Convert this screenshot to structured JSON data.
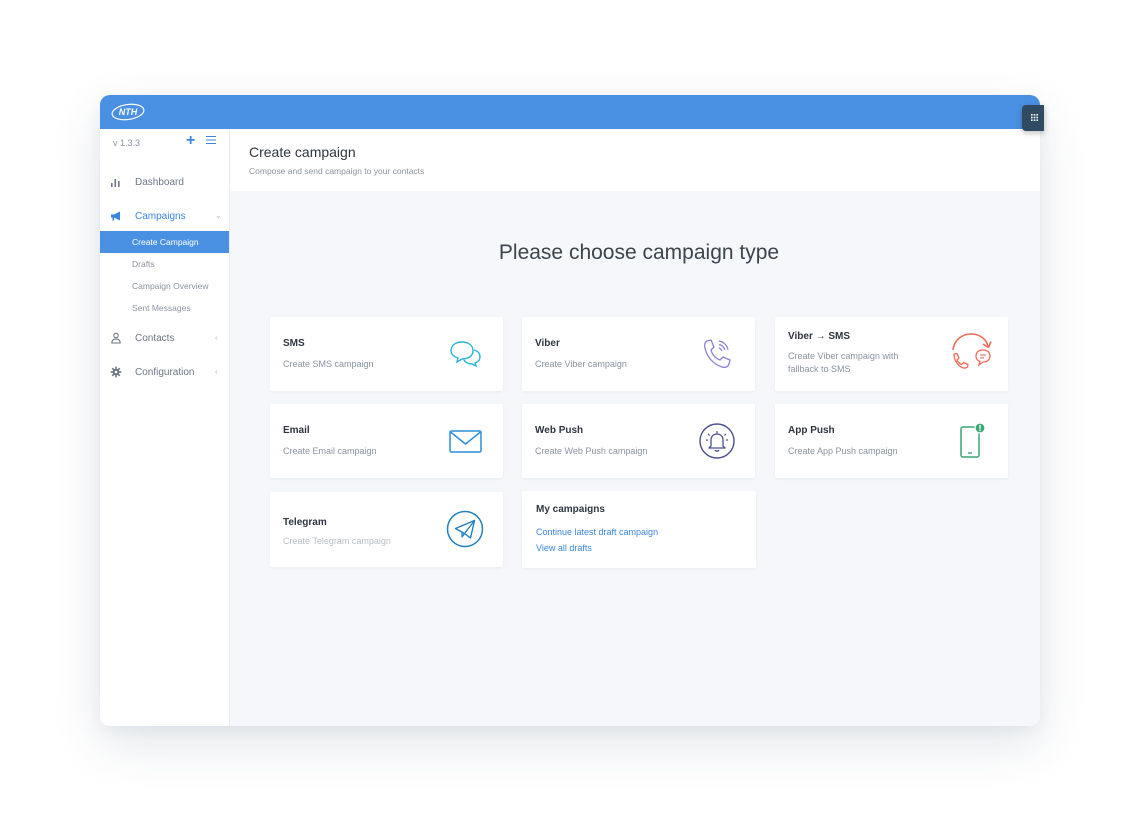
{
  "app": {
    "logo_text": "NTH",
    "version": "v 1.3.3",
    "accent_color": "#4a90e2"
  },
  "sidebar": {
    "add_icon": "plus-icon",
    "menu_icon": "hamburger-icon",
    "items": [
      {
        "label": "Dashboard",
        "icon": "bar-chart-icon"
      },
      {
        "label": "Campaigns",
        "icon": "megaphone-icon",
        "caret": "⌄"
      },
      {
        "label": "Contacts",
        "icon": "user-icon",
        "caret": "‹"
      },
      {
        "label": "Configuration",
        "icon": "gear-icon",
        "caret": "‹"
      }
    ],
    "sub_items": [
      {
        "label": "Create Campaign",
        "active": true
      },
      {
        "label": "Drafts"
      },
      {
        "label": "Campaign Overview"
      },
      {
        "label": "Sent Messages"
      }
    ]
  },
  "header": {
    "title": "Create campaign",
    "subtitle": "Compose and send campaign to your contacts"
  },
  "main": {
    "heading": "Please choose campaign type",
    "cards": [
      {
        "title": "SMS",
        "desc": "Create SMS campaign",
        "icon": "chat-bubbles-icon"
      },
      {
        "title": "Viber",
        "desc": "Create Viber campaign",
        "icon": "phone-ringing-icon"
      },
      {
        "title": "Viber → SMS",
        "desc": "Create Viber campaign with fallback to SMS",
        "icon": "fallback-arrow-icon"
      },
      {
        "title": "Email",
        "desc": "Create Email campaign",
        "icon": "envelope-icon"
      },
      {
        "title": "Web Push",
        "desc": "Create Web Push campaign",
        "icon": "bell-icon"
      },
      {
        "title": "App Push",
        "desc": "Create App Push campaign",
        "icon": "mobile-notification-icon"
      },
      {
        "title": "Telegram",
        "desc": "Create Telegram campaign",
        "icon": "paper-plane-icon"
      }
    ],
    "my_campaigns": {
      "title": "My campaigns",
      "continue_link": "Continue latest draft campaign",
      "drafts_link": "View all drafts"
    }
  }
}
